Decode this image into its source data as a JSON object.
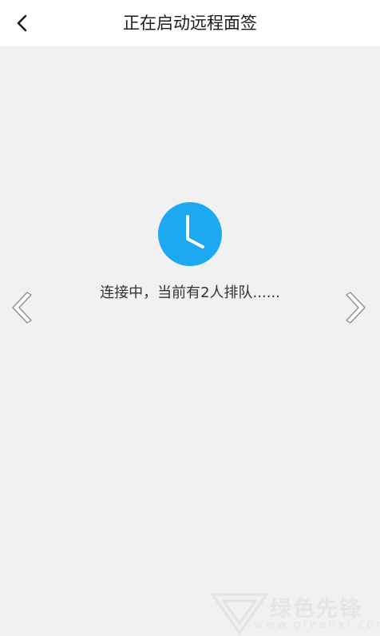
{
  "header": {
    "title": "正在启动远程面签"
  },
  "main": {
    "status_text": "连接中，当前有2人排队......"
  },
  "icons": {
    "back": "chevron-left-icon",
    "clock": "clock-icon",
    "prev": "chevron-left-outline-icon",
    "next": "chevron-right-outline-icon"
  },
  "colors": {
    "accent": "#1ca9f1",
    "background": "#f1f1f1",
    "header_background": "#ffffff",
    "text": "#333333"
  },
  "watermark": {
    "brand": "绿色先锋",
    "url": "www.greenxf.com"
  }
}
